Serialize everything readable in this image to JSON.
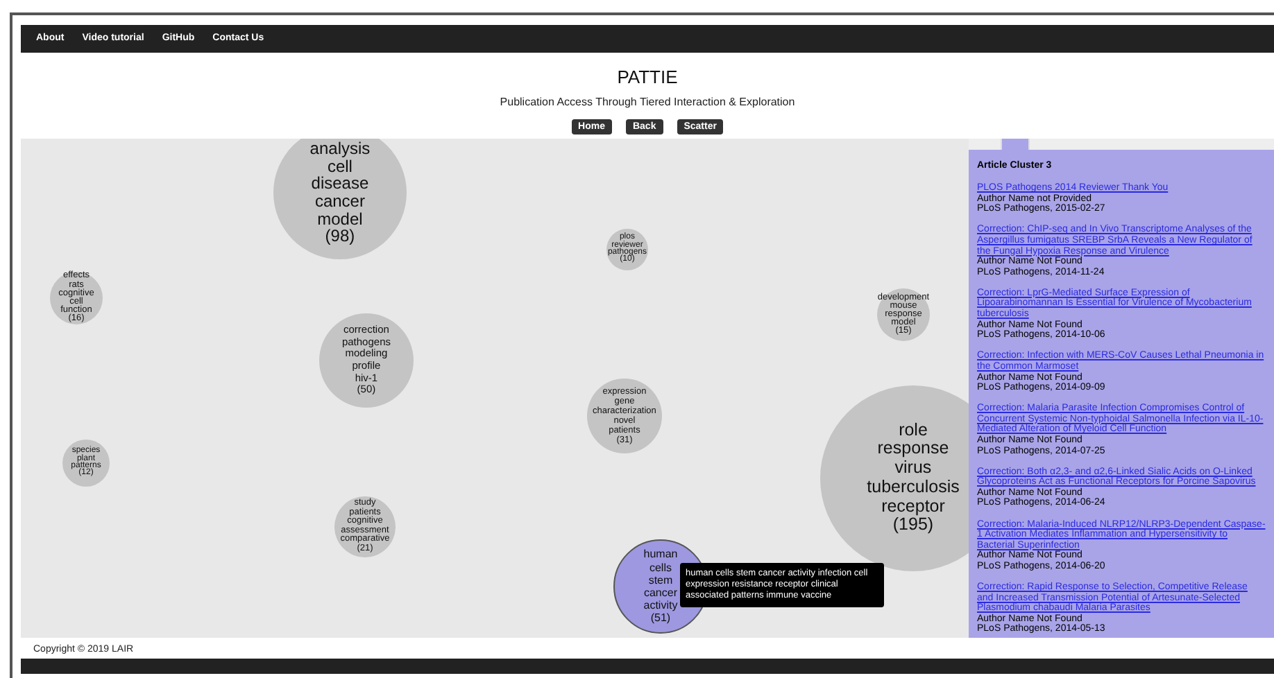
{
  "nav": [
    "About",
    "Video tutorial",
    "GitHub",
    "Contact Us"
  ],
  "header": {
    "title": "PATTIE",
    "subtitle": "Publication Access Through Tiered Interaction & Exploration"
  },
  "buttons": [
    "Home",
    "Back",
    "Scatter"
  ],
  "clusters": [
    {
      "terms": [
        "analysis",
        "cell",
        "disease",
        "cancer",
        "model"
      ],
      "count": "(98)",
      "selected": false
    },
    {
      "terms": [
        "effects",
        "rats",
        "cognitive",
        "cell",
        "function"
      ],
      "count": "(16)",
      "selected": false
    },
    {
      "terms": [
        "correction",
        "pathogens",
        "modeling",
        "profile",
        "hiv-1"
      ],
      "count": "(50)",
      "selected": false
    },
    {
      "terms": [
        "plos",
        "reviewer",
        "pathogens"
      ],
      "count": "(10)",
      "selected": false
    },
    {
      "terms": [
        "development",
        "mouse",
        "response",
        "model"
      ],
      "count": "(15)",
      "selected": false
    },
    {
      "terms": [
        "expression",
        "gene",
        "characterization",
        "novel",
        "patients"
      ],
      "count": "(31)",
      "selected": false
    },
    {
      "terms": [
        "species",
        "plant",
        "patterns"
      ],
      "count": "(12)",
      "selected": false
    },
    {
      "terms": [
        "study",
        "patients",
        "cognitive",
        "assessment",
        "comparative"
      ],
      "count": "(21)",
      "selected": false
    },
    {
      "terms": [
        "human",
        "cells",
        "stem",
        "cancer",
        "activity"
      ],
      "count": "(51)",
      "selected": true
    },
    {
      "terms": [
        "role",
        "response",
        "virus",
        "tuberculosis",
        "receptor"
      ],
      "count": "(195)",
      "selected": false
    }
  ],
  "tooltip": "human cells stem cancer activity infection cell expression resistance receptor clinical associated patterns immune vaccine",
  "panel": {
    "title": "Article Cluster 3",
    "articles": [
      {
        "title": "PLOS Pathogens 2014 Reviewer Thank You",
        "author": "Author Name not Provided",
        "source": "PLoS Pathogens, 2015-02-27"
      },
      {
        "title": "Correction: ChIP-seq and In Vivo Transcriptome Analyses of the Aspergillus fumigatus SREBP SrbA Reveals a New Regulator of the Fungal Hypoxia Response and Virulence",
        "author": "Author Name Not Found",
        "source": "PLoS Pathogens, 2014-11-24"
      },
      {
        "title": "Correction: LprG-Mediated Surface Expression of Lipoarabinomannan Is Essential for Virulence of Mycobacterium tuberculosis",
        "author": "Author Name Not Found",
        "source": "PLoS Pathogens, 2014-10-06"
      },
      {
        "title": "Correction: Infection with MERS-CoV Causes Lethal Pneumonia in the Common Marmoset",
        "author": "Author Name Not Found",
        "source": "PLoS Pathogens, 2014-09-09"
      },
      {
        "title": "Correction: Malaria Parasite Infection Compromises Control of Concurrent Systemic Non-typhoidal Salmonella Infection via IL-10-Mediated Alteration of Myeloid Cell Function",
        "author": "Author Name Not Found",
        "source": "PLoS Pathogens, 2014-07-25"
      },
      {
        "title": "Correction: Both α2,3- and α2,6-Linked Sialic Acids on O-Linked Glycoproteins Act as Functional Receptors for Porcine Sapovirus",
        "author": "Author Name Not Found",
        "source": "PLoS Pathogens, 2014-06-24"
      },
      {
        "title": "Correction: Malaria-Induced NLRP12/NLRP3-Dependent Caspase-1 Activation Mediates Inflammation and Hypersensitivity to Bacterial Superinfection",
        "author": "Author Name Not Found",
        "source": "PLoS Pathogens, 2014-06-20"
      },
      {
        "title": "Correction: Rapid Response to Selection, Competitive Release and Increased Transmission Potential of Artesunate-Selected Plasmodium chabaudi Malaria Parasites",
        "author": "Author Name Not Found",
        "source": "PLoS Pathogens, 2014-05-13"
      }
    ]
  },
  "footer": "Copyright © 2019 LAIR"
}
